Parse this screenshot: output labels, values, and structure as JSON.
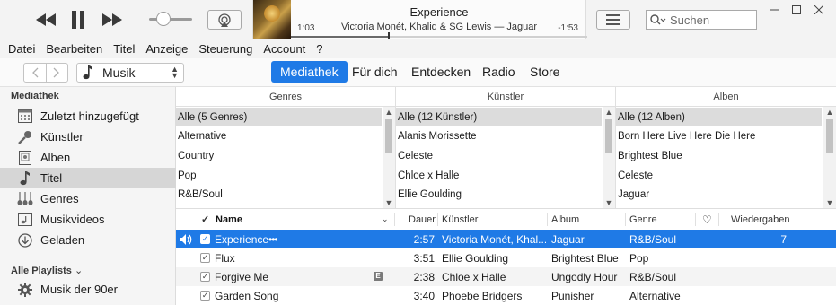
{
  "player": {
    "now_playing_title": "Experience",
    "now_playing_subtitle": "Victoria Monét, Khalid & SG Lewis — Jaguar",
    "elapsed": "1:03",
    "remaining": "-1:53",
    "progress": 0.33,
    "volume": 0.3
  },
  "search": {
    "placeholder": "Suchen"
  },
  "menu": [
    "Datei",
    "Bearbeiten",
    "Titel",
    "Anzeige",
    "Steuerung",
    "Account",
    "?"
  ],
  "nav": {
    "media_type": "Musik",
    "tabs": [
      {
        "label": "Mediathek",
        "active": true
      },
      {
        "label": "Für dich",
        "active": false
      },
      {
        "label": "Entdecken",
        "active": false
      },
      {
        "label": "Radio",
        "active": false
      },
      {
        "label": "Store",
        "active": false
      }
    ]
  },
  "sidebar": {
    "library_heading": "Mediathek",
    "items": [
      {
        "label": "Zuletzt hinzugefügt",
        "icon": "grid-calendar-icon"
      },
      {
        "label": "Künstler",
        "icon": "microphone-icon"
      },
      {
        "label": "Alben",
        "icon": "album-icon"
      },
      {
        "label": "Titel",
        "icon": "music-note-icon",
        "selected": true
      },
      {
        "label": "Genres",
        "icon": "guitar-icon"
      },
      {
        "label": "Musikvideos",
        "icon": "video-icon"
      },
      {
        "label": "Geladen",
        "icon": "download-icon"
      }
    ],
    "playlists_heading": "Alle Playlists",
    "playlists": [
      {
        "label": "Musik der 90er",
        "icon": "gear-icon"
      }
    ]
  },
  "browser": {
    "genres": {
      "header": "Genres",
      "rows": [
        "Alle (5 Genres)",
        "Alternative",
        "Country",
        "Pop",
        "R&B/Soul"
      ]
    },
    "artists": {
      "header": "Künstler",
      "rows": [
        "Alle (12 Künstler)",
        "Alanis Morissette",
        "Celeste",
        "Chloe x Halle",
        "Ellie Goulding"
      ]
    },
    "albums": {
      "header": "Alben",
      "rows": [
        "Alle (12 Alben)",
        "Born Here Live Here Die Here",
        "Brightest Blue",
        "Celeste",
        "Jaguar"
      ]
    }
  },
  "songlist": {
    "headers": {
      "check": "✓",
      "name": "Name",
      "duration": "Dauer",
      "artist": "Künstler",
      "album": "Album",
      "genre": "Genre",
      "love": "♡",
      "plays": "Wiedergaben"
    },
    "rows": [
      {
        "name": "Experience",
        "more": "•••",
        "duration": "2:57",
        "artist": "Victoria Monét, Khal...",
        "album": "Jaguar",
        "genre": "R&B/Soul",
        "plays": "7",
        "playing": true,
        "checked": true,
        "explicit": false
      },
      {
        "name": "Flux",
        "duration": "3:51",
        "artist": "Ellie Goulding",
        "album": "Brightest Blue",
        "genre": "Pop",
        "plays": "",
        "playing": false,
        "checked": true,
        "explicit": false
      },
      {
        "name": "Forgive Me",
        "duration": "2:38",
        "artist": "Chloe x Halle",
        "album": "Ungodly Hour",
        "genre": "R&B/Soul",
        "plays": "",
        "playing": false,
        "checked": true,
        "explicit": true,
        "explicit_label": "E"
      },
      {
        "name": "Garden Song",
        "duration": "3:40",
        "artist": "Phoebe Bridgers",
        "album": "Punisher",
        "genre": "Alternative",
        "plays": "",
        "playing": false,
        "checked": true,
        "explicit": false
      }
    ]
  },
  "colors": {
    "accent": "#1f7ae6",
    "selection_gray": "#dcdcdc",
    "sidebar_bg": "#f5f5f5"
  }
}
